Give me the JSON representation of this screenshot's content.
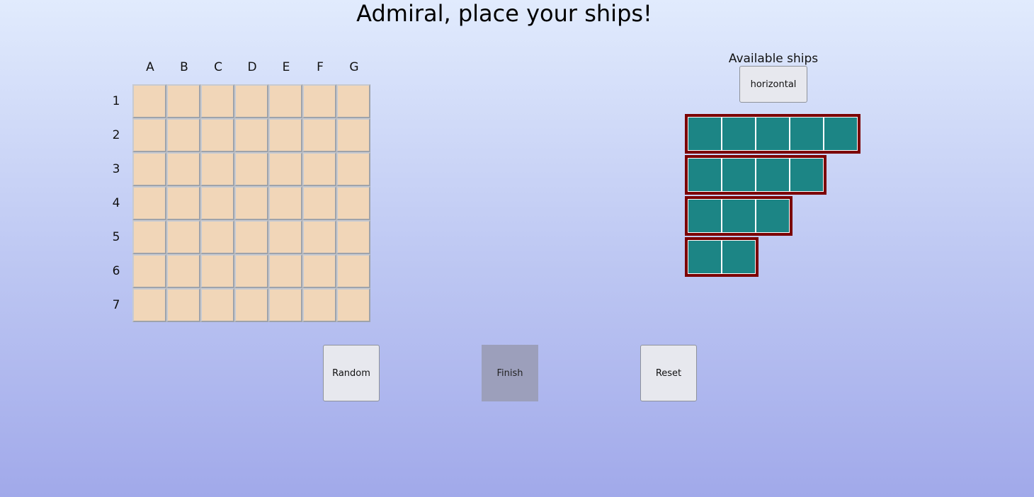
{
  "title": "Admiral, place your ships!",
  "board": {
    "columns": [
      "A",
      "B",
      "C",
      "D",
      "E",
      "F",
      "G"
    ],
    "rows": [
      "1",
      "2",
      "3",
      "4",
      "5",
      "6",
      "7"
    ]
  },
  "ships_panel": {
    "title": "Available ships",
    "orientation_label": "horizontal",
    "ships": [
      {
        "length": 5
      },
      {
        "length": 4
      },
      {
        "length": 3
      },
      {
        "length": 2
      }
    ]
  },
  "actions": {
    "random_label": "Random",
    "finish_label": "Finish",
    "reset_label": "Reset"
  },
  "colors": {
    "cell": "#f1d6b8",
    "ship": "#1c8585",
    "ship_border": "#7b0000",
    "finish_disabled": "#9c9fbb"
  }
}
